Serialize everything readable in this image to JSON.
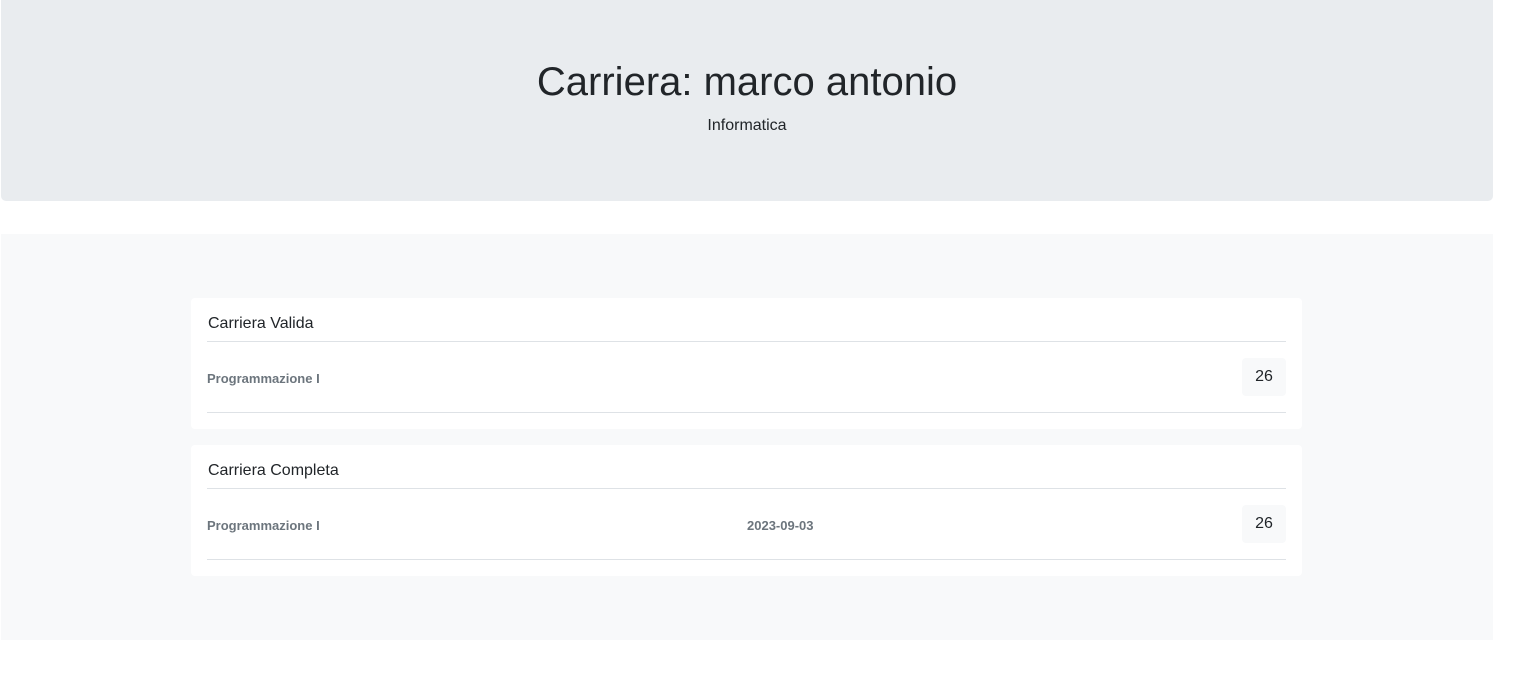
{
  "header": {
    "title": "Carriera: marco antonio",
    "subtitle": "Informatica"
  },
  "cards": [
    {
      "title": "Carriera Valida",
      "rows": [
        {
          "course": "Programmazione I",
          "grade": "26"
        }
      ]
    },
    {
      "title": "Carriera Completa",
      "rows": [
        {
          "course": "Programmazione I",
          "date": "2023-09-03",
          "grade": "26"
        }
      ]
    }
  ]
}
